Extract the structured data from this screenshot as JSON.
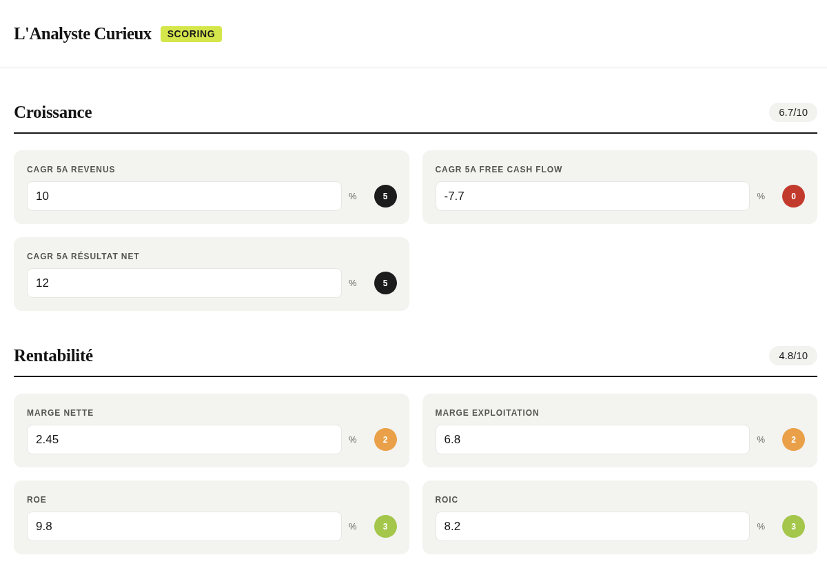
{
  "header": {
    "logo": "L'Analyste Curieux",
    "badge": "SCORING"
  },
  "sections": [
    {
      "title": "Croissance",
      "score": "6.7/10",
      "metrics": [
        {
          "label": "CAGR 5A REVENUS",
          "value": "10",
          "unit": "%",
          "score": "5",
          "color": "#1c1c1c"
        },
        {
          "label": "CAGR 5A FREE CASH FLOW",
          "value": "-7.7",
          "unit": "%",
          "score": "0",
          "color": "#c23a2c"
        },
        {
          "label": "CAGR 5A RÉSULTAT NET",
          "value": "12",
          "unit": "%",
          "score": "5",
          "color": "#1c1c1c"
        }
      ]
    },
    {
      "title": "Rentabilité",
      "score": "4.8/10",
      "metrics": [
        {
          "label": "MARGE NETTE",
          "value": "2.45",
          "unit": "%",
          "score": "2",
          "color": "#e9a048"
        },
        {
          "label": "MARGE EXPLOITATION",
          "value": "6.8",
          "unit": "%",
          "score": "2",
          "color": "#e9a048"
        },
        {
          "label": "ROE",
          "value": "9.8",
          "unit": "%",
          "score": "3",
          "color": "#a4c64a"
        },
        {
          "label": "ROIC",
          "value": "8.2",
          "unit": "%",
          "score": "3",
          "color": "#a4c64a"
        }
      ]
    }
  ]
}
